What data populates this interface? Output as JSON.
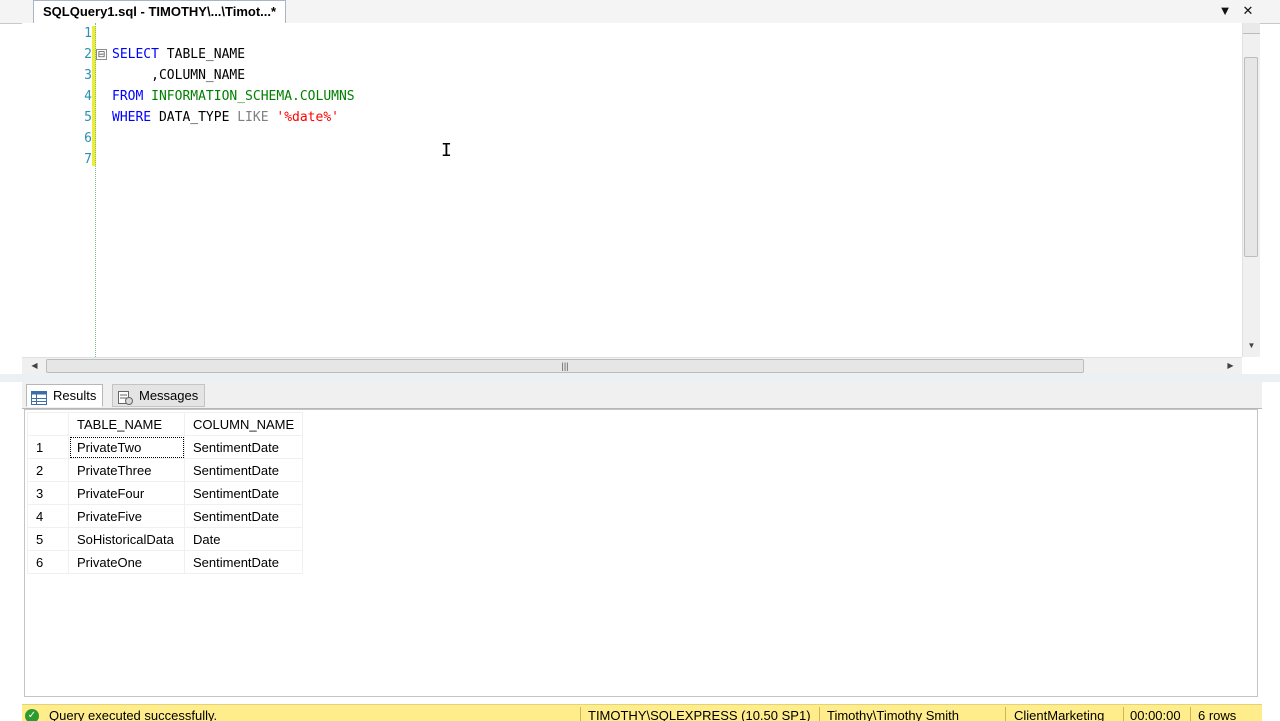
{
  "document_tab": {
    "title": "SQLQuery1.sql - TIMOTHY\\...\\Timot...*"
  },
  "tab_controls": {
    "dropdown_icon": "▼",
    "close_icon": "✕"
  },
  "editor": {
    "line_numbers": [
      "1",
      "2",
      "3",
      "4",
      "5",
      "6",
      "7"
    ],
    "collapse_icon": "⊟",
    "lines": [
      [],
      [
        {
          "t": "SELECT",
          "c": "kw"
        },
        {
          "t": " TABLE_NAME",
          "c": "obj"
        }
      ],
      [
        {
          "t": "     ,COLUMN_NAME",
          "c": "obj"
        }
      ],
      [
        {
          "t": "FROM",
          "c": "kw"
        },
        {
          "t": " ",
          "c": "obj"
        },
        {
          "t": "INFORMATION_SCHEMA.COLUMNS",
          "c": "sys"
        }
      ],
      [
        {
          "t": "WHERE",
          "c": "kw"
        },
        {
          "t": " DATA_TYPE ",
          "c": "obj"
        },
        {
          "t": "LIKE",
          "c": "op"
        },
        {
          "t": " ",
          "c": "obj"
        },
        {
          "t": "'%date%'",
          "c": "str"
        }
      ],
      [],
      []
    ],
    "colors": {
      "keyword": "#0000ff",
      "system": "#008000",
      "operator": "#808080",
      "string": "#ff0000",
      "line_number": "#2b91af"
    }
  },
  "results_tabs": [
    {
      "label": "Results",
      "icon": "grid-icon"
    },
    {
      "label": "Messages",
      "icon": "messages-icon"
    }
  ],
  "grid": {
    "columns": [
      "TABLE_NAME",
      "COLUMN_NAME"
    ],
    "rows": [
      [
        "1",
        "PrivateTwo",
        "SentimentDate"
      ],
      [
        "2",
        "PrivateThree",
        "SentimentDate"
      ],
      [
        "3",
        "PrivateFour",
        "SentimentDate"
      ],
      [
        "4",
        "PrivateFive",
        "SentimentDate"
      ],
      [
        "5",
        "SoHistoricalData",
        "Date"
      ],
      [
        "6",
        "PrivateOne",
        "SentimentDate"
      ]
    ]
  },
  "status": {
    "message": "Query executed successfully.",
    "server": "TIMOTHY\\SQLEXPRESS (10.50 SP1)",
    "user": "Timothy\\Timothy Smith",
    "database": "ClientMarketing",
    "elapsed": "00:00:00",
    "rows": "6 rows",
    "bar_color": "#ffed8c"
  }
}
